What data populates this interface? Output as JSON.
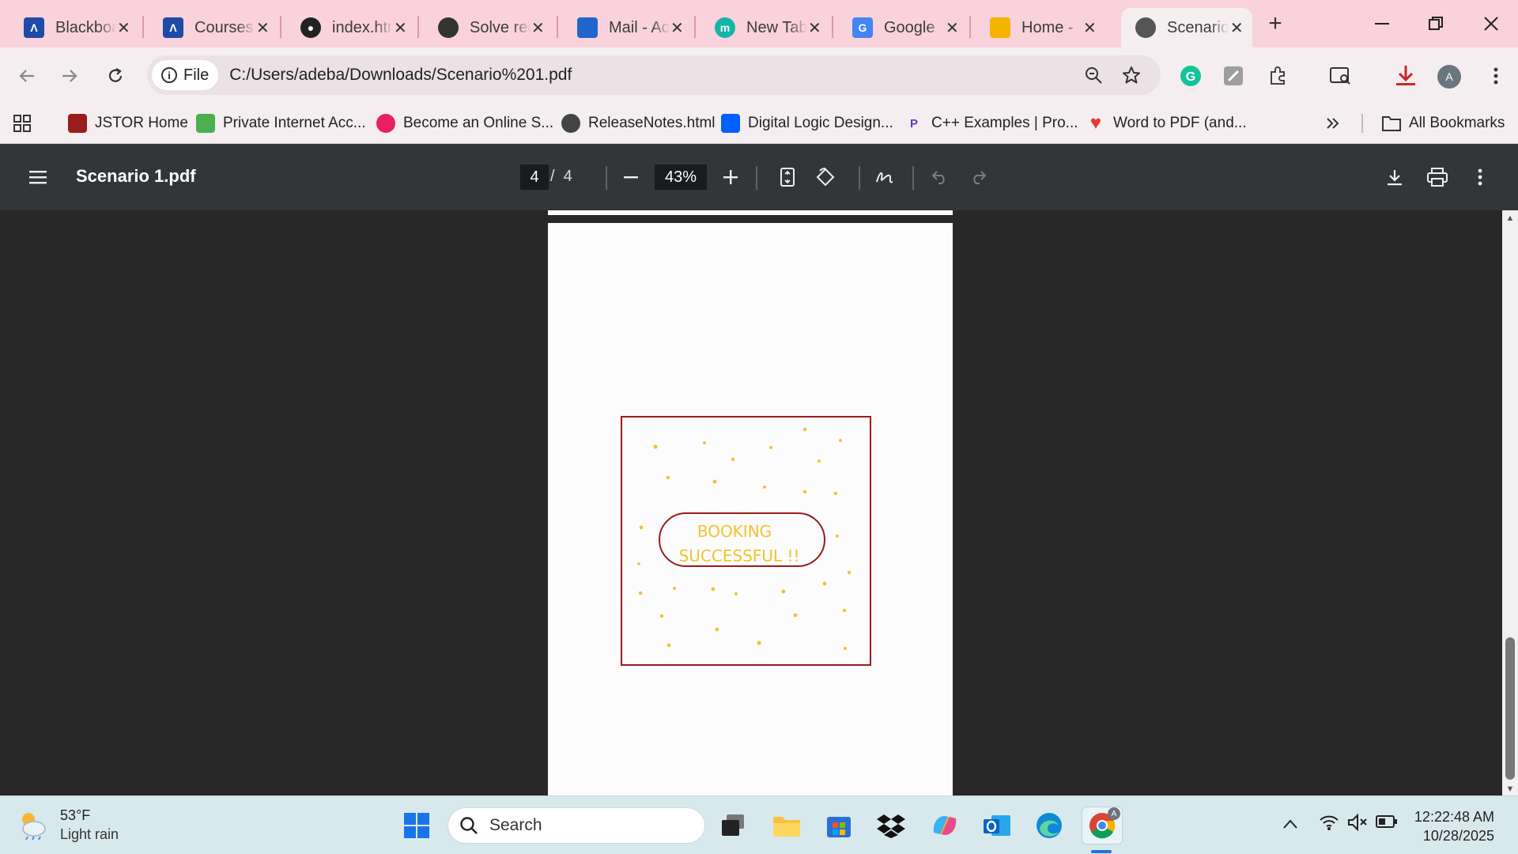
{
  "tabs": [
    {
      "title": "Blackboard",
      "icon": "blackboard-icon",
      "color": "#1e4ba8"
    },
    {
      "title": "Courses",
      "icon": "blackboard-icon",
      "color": "#1e4ba8"
    },
    {
      "title": "index.html",
      "icon": "github-icon",
      "color": "#222222"
    },
    {
      "title": "Solve rec",
      "icon": "openai-icon",
      "color": "#333333"
    },
    {
      "title": "Mail - Ac",
      "icon": "outlook-icon",
      "color": "#2266cc"
    },
    {
      "title": "New Tab",
      "icon": "m-icon",
      "color": "#12b5a6"
    },
    {
      "title": "Google",
      "icon": "google-icon",
      "color": "#4285f4"
    },
    {
      "title": "Home -",
      "icon": "google-drive-icon",
      "color": "#f4b400"
    },
    {
      "title": "Scenario",
      "icon": "globe-icon",
      "color": "#555555"
    }
  ],
  "address": {
    "chip_label": "File",
    "url": "C:/Users/adeba/Downloads/Scenario%201.pdf"
  },
  "bookmarks": [
    {
      "label": "JSTOR Home",
      "icon": "jstor-icon",
      "color": "#9b1c1c"
    },
    {
      "label": "Private Internet Acc...",
      "icon": "lock-icon",
      "color": "#4caf50"
    },
    {
      "label": "Become an Online S...",
      "icon": "ring-icon",
      "color": "#e91e63"
    },
    {
      "label": "ReleaseNotes.html",
      "icon": "globe-icon",
      "color": "#444444"
    },
    {
      "label": "Digital Logic Design...",
      "icon": "dropbox-icon",
      "color": "#0061fe"
    },
    {
      "label": "C++ Examples | Pro...",
      "icon": "p-icon",
      "color": "#5b3cc4"
    },
    {
      "label": "Word to PDF (and...",
      "icon": "heart-icon",
      "color": "#e53935"
    }
  ],
  "all_bookmarks_label": "All Bookmarks",
  "profile_initial": "A",
  "pdf": {
    "title": "Scenario 1.pdf",
    "page_current": "4",
    "page_total": "4",
    "zoom": "43%"
  },
  "taskbar": {
    "weather_temp": "53°F",
    "weather_desc": "Light rain",
    "search_label": "Search",
    "time": "12:22:48 AM",
    "date": "10/28/2025"
  }
}
